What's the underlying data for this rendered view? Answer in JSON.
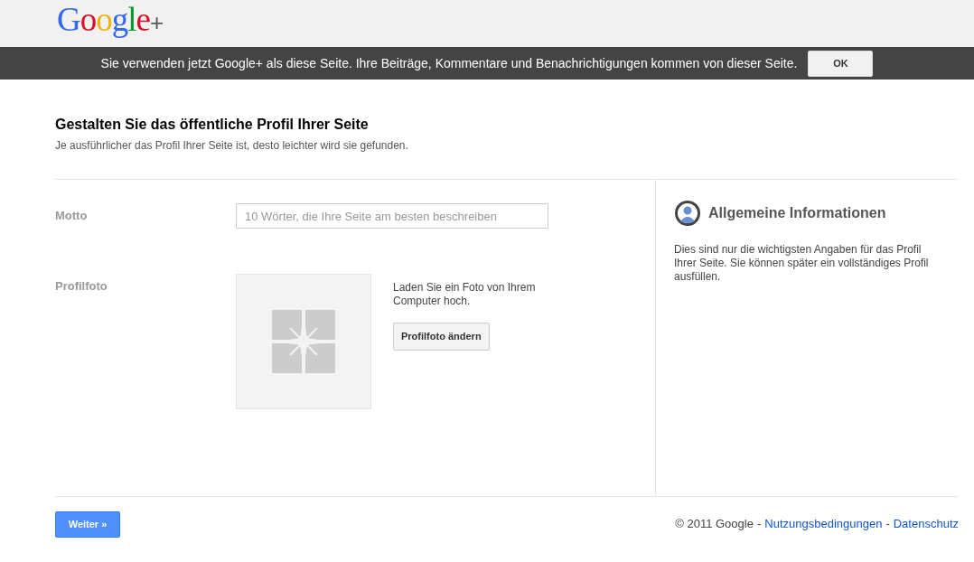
{
  "header": {
    "logo": "Google+"
  },
  "banner": {
    "message": "Sie verwenden jetzt Google+ als diese Seite. Ihre Beiträge, Kommentare und Benachrichtigungen kommen von dieser Seite.",
    "button": "OK"
  },
  "intro": {
    "title": "Gestalten Sie das öffentliche Profil Ihrer Seite",
    "subtitle": "Je ausführlicher das Profil Ihrer Seite ist, desto leichter wird sie gefunden."
  },
  "form": {
    "motto": {
      "label": "Motto",
      "placeholder": "10 Wörter, die Ihre Seite am besten beschreiben"
    },
    "photo": {
      "label": "Profilfoto",
      "hint": "Laden Sie ein Foto von Ihrem Computer hoch.",
      "button": "Profilfoto ändern"
    }
  },
  "info": {
    "title": "Allgemeine Informationen",
    "text": "Dies sind nur die wichtigsten Angaben für das Profil Ihrer Seite. Sie können später ein vollständiges Profil ausfüllen."
  },
  "next_button": "Weiter »",
  "footer": {
    "copyright": "© 2011 Google",
    "separator_1": "-",
    "link_1": "Nutzungsbedingungen",
    "separator_2": "-",
    "link_2": "Datenschutz"
  }
}
